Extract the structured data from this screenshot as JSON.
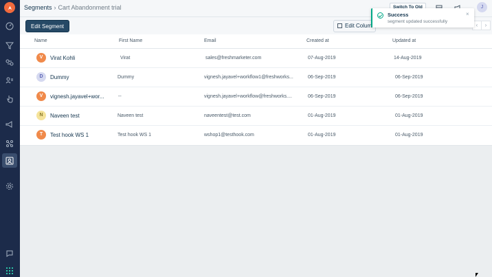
{
  "header": {
    "breadcrumb_root": "Segments",
    "breadcrumb_sep": "›",
    "breadcrumb_current": "Cart Abandonment trial",
    "switch_label": "Switch To Old",
    "avatar_initial": "J"
  },
  "toolbar": {
    "edit_segment_label": "Edit Segment",
    "edit_columns_label": "Edit Columns",
    "prev_label": "‹",
    "next_label": "›"
  },
  "table": {
    "columns": [
      "Name",
      "First Name",
      "Email",
      "Created at",
      "Updated at"
    ],
    "rows": [
      {
        "initial": "V",
        "color": "#f08a4b",
        "name": "Virat Kohli",
        "first_name": "Virat",
        "email": "sales@freshmarketer.com",
        "created": "07-Aug-2019",
        "updated": "14-Aug-2019"
      },
      {
        "initial": "D",
        "color": "#d5d9f0",
        "name": "Dummy",
        "first_name": "Dummy",
        "email": "vignesh.jayavel+workflow1@freshworks...",
        "created": "06-Sep-2019",
        "updated": "06-Sep-2019"
      },
      {
        "initial": "V",
        "color": "#f08a4b",
        "name": "vignesh.jayavel+wor...",
        "first_name": "--",
        "email": "vignesh.jayavel+workflow@freshworks....",
        "created": "06-Sep-2019",
        "updated": "06-Sep-2019"
      },
      {
        "initial": "N",
        "color": "#f5e39a",
        "name": "Naveen test",
        "first_name": "Naveen test",
        "email": "naveentest@test.com",
        "created": "01-Aug-2019",
        "updated": "01-Aug-2019"
      },
      {
        "initial": "T",
        "color": "#f08a4b",
        "name": "Test hook WS 1",
        "first_name": "Test hook WS 1",
        "email": "wshop1@testhook.com",
        "created": "01-Aug-2019",
        "updated": "01-Aug-2019"
      }
    ]
  },
  "toast": {
    "title": "Success",
    "message": "segment updated successfully",
    "close_label": "×",
    "accent_color": "#00a886"
  },
  "sidebar": {
    "items": [
      "dashboard-icon",
      "funnel-icon",
      "journey-icon",
      "contacts-icon",
      "touch-icon",
      "campaign-icon",
      "workflow-icon",
      "segments-icon",
      "settings-icon",
      "chat-icon",
      "apps-grid-icon"
    ]
  },
  "colors": {
    "sidebar_bg": "#1c2b4a",
    "brand": "#f26a3d",
    "primary_button": "#264966"
  }
}
